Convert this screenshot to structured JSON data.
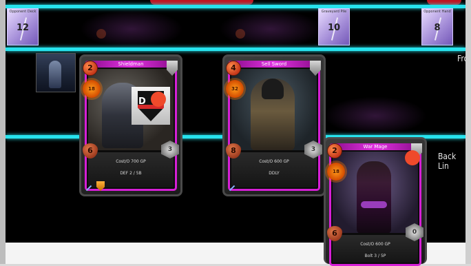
{
  "decks": [
    {
      "label": "Opponent Deck",
      "count": "12"
    },
    {
      "label": "Graveyard Pile",
      "count": "10"
    },
    {
      "label": "Opponent Hand",
      "count": "8"
    }
  ],
  "side_labels": {
    "right_top": "Fro",
    "right_mid": "Back Lin"
  },
  "cards": [
    {
      "name": "Shieldman",
      "mana": "2",
      "attack": "18",
      "health": "6",
      "defense": "3",
      "cost": "Cost/O 700 GP",
      "stats": "DEF 2 / 5B"
    },
    {
      "name": "Sell Sword",
      "mana": "4",
      "attack": "32",
      "health": "8",
      "defense": "3",
      "cost": "Cost/O 600 GP",
      "stats": "DDLY"
    },
    {
      "name": "War Mage",
      "mana": "2",
      "attack": "18",
      "health": "6",
      "defense": "0",
      "cost": "Cost/O 600 GP",
      "stats": "Bolt 3 / 5P"
    }
  ],
  "overlay_icon": {
    "letter": "D"
  },
  "colors": {
    "lane": "#27e3ee",
    "card_frame": "#d61fd6",
    "accent_red": "#c1121f"
  }
}
